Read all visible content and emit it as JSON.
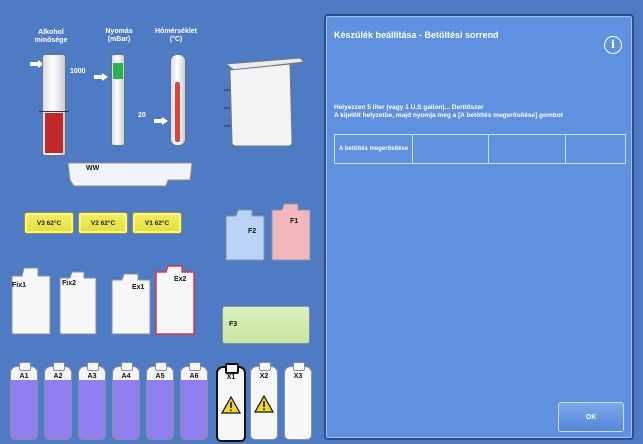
{
  "gauges": {
    "alcohol_label": "Alkohol minősége",
    "pressure_label": "Nyomás (mBar)",
    "temperature_label": "Hőmérséklet (°C)",
    "pressure_value": "1000",
    "temperature_value": "20"
  },
  "containers": {
    "waste": "WW",
    "heaters": [
      "V3 62°C",
      "V2 62°C",
      "V1 62°C"
    ],
    "f2": "F2",
    "f1": "F1",
    "fix1": "Fix1",
    "fix2": "Fix2",
    "ex1": "Ex1",
    "ex2": "Ex2",
    "f3": "F3"
  },
  "bottles": [
    "A1",
    "A2",
    "A3",
    "A4",
    "A5",
    "A6",
    "X1",
    "X2",
    "X3"
  ],
  "panel": {
    "title": "Készülék beállítása - Betöltési sorrend",
    "info": "i",
    "message_line1": "Helyezzen 5 liter (vagy 1 U.S gallon)... Derítőszer",
    "message_line2": "A kijelölt helyzetbe, majd nyomja meg a [A betöltés megerősítése] gombot",
    "slot1_label": "A betöltés megerősítése",
    "ok_label": "OK"
  },
  "colors": {
    "background": "#4f7bc4",
    "panel": "#5f91e0",
    "alcohol_fill": "#c0282a",
    "pressure_fill": "#29b34a",
    "temperature_fill": "#d9463e",
    "heater_yellow": "#e8e440",
    "f2_blue": "#b9d4f6",
    "f1_pink": "#f2b8bd",
    "f3_green": "#c9e6a0",
    "ex2_outline": "#d83a3a",
    "bottle_purple": "#8f7ff0"
  }
}
